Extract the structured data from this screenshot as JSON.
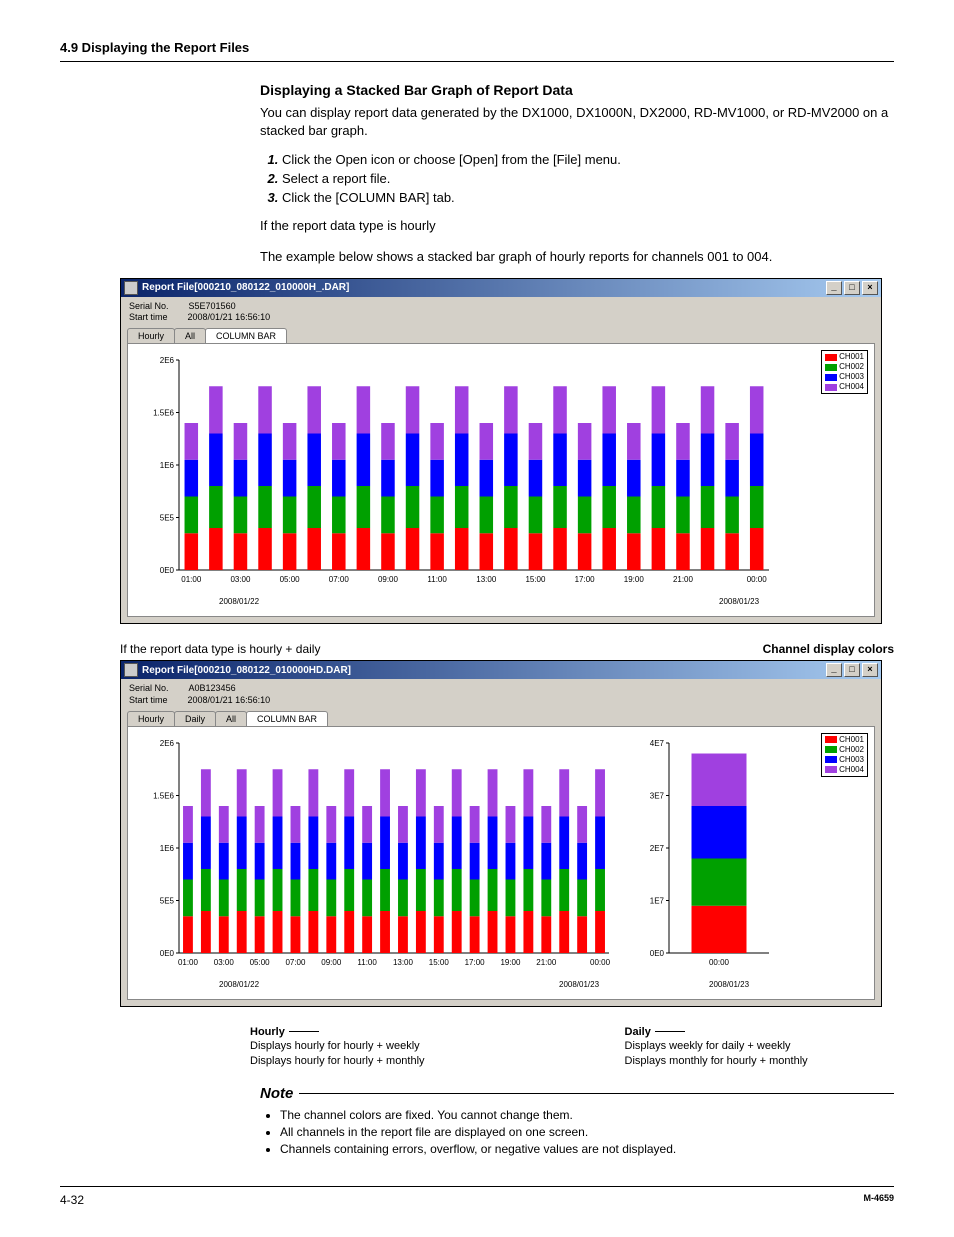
{
  "page": {
    "header": "4.9  Displaying the Report Files",
    "footer_left": "4-32",
    "footer_right": "M-4659"
  },
  "body": {
    "title": "Displaying a Stacked Bar Graph of Report Data",
    "intro": "You can display report data generated by the DX1000, DX1000N, DX2000, RD-MV1000, or RD-MV2000 on a stacked bar graph.",
    "steps": [
      "Click the Open icon or choose [Open] from the [File] menu.",
      "Select a report file.",
      "Click the [COLUMN BAR] tab."
    ],
    "if_hourly_head": "If the report data type is hourly",
    "if_hourly_text": "The example below shows a stacked bar graph of hourly reports for channels 001 to 004.",
    "caption_hourly_daily": "If the report data type is hourly + daily",
    "caption_channel_colors": "Channel display colors",
    "annotations": {
      "hourly": {
        "title": "Hourly",
        "lines": [
          "Displays hourly for hourly + weekly",
          "Displays hourly for hourly + monthly"
        ]
      },
      "daily": {
        "title": "Daily",
        "lines": [
          "Displays weekly for daily + weekly",
          "Displays monthly for hourly + monthly"
        ]
      }
    },
    "note_title": "Note",
    "notes": [
      "The channel colors are fixed. You cannot change them.",
      "All channels in the report file are displayed on one screen.",
      "Channels containing errors, overflow, or negative values are not displayed."
    ]
  },
  "window1": {
    "title": "Report File[000210_080122_010000H_.DAR]",
    "serial_label": "Serial No.",
    "serial_value": "S5E701560",
    "start_label": "Start time",
    "start_value": "2008/01/21 16:56:10",
    "tabs": [
      "Hourly",
      "All",
      "COLUMN BAR"
    ],
    "active_tab": 2,
    "dates": [
      "2008/01/22",
      "2008/01/23"
    ]
  },
  "window2": {
    "title": "Report File[000210_080122_010000HD.DAR]",
    "serial_label": "Serial No.",
    "serial_value": "A0B123456",
    "start_label": "Start time",
    "start_value": "2008/01/21 16:56:10",
    "tabs": [
      "Hourly",
      "Daily",
      "All",
      "COLUMN BAR"
    ],
    "active_tab": 3,
    "dates": [
      "2008/01/22",
      "2008/01/23",
      "2008/01/23"
    ]
  },
  "legend": [
    {
      "name": "CH001",
      "color": "#ff0000"
    },
    {
      "name": "CH002",
      "color": "#00a000"
    },
    {
      "name": "CH003",
      "color": "#0000ff"
    },
    {
      "name": "CH004",
      "color": "#a040e0"
    }
  ],
  "chart_data": [
    {
      "type": "bar",
      "stacked": true,
      "title": "Hourly report stacked bar",
      "ylabel": "",
      "ylim": [
        0,
        2000000
      ],
      "y_ticks_labels": [
        "0E0",
        "5E5",
        "1E6",
        "1.5E6",
        "2E6"
      ],
      "x_label_positions": [
        "01:00",
        "03:00",
        "05:00",
        "07:00",
        "09:00",
        "11:00",
        "13:00",
        "15:00",
        "17:00",
        "19:00",
        "21:00",
        "00:00"
      ],
      "categories": [
        "01:00",
        "02:00",
        "03:00",
        "04:00",
        "05:00",
        "06:00",
        "07:00",
        "08:00",
        "09:00",
        "10:00",
        "11:00",
        "12:00",
        "13:00",
        "14:00",
        "15:00",
        "16:00",
        "17:00",
        "18:00",
        "19:00",
        "20:00",
        "21:00",
        "22:00",
        "23:00",
        "00:00"
      ],
      "series": [
        {
          "name": "CH001",
          "color": "#ff0000",
          "values": [
            350000,
            400000,
            350000,
            400000,
            350000,
            400000,
            350000,
            400000,
            350000,
            400000,
            350000,
            400000,
            350000,
            400000,
            350000,
            400000,
            350000,
            400000,
            350000,
            400000,
            350000,
            400000,
            350000,
            400000
          ]
        },
        {
          "name": "CH002",
          "color": "#00a000",
          "values": [
            350000,
            400000,
            350000,
            400000,
            350000,
            400000,
            350000,
            400000,
            350000,
            400000,
            350000,
            400000,
            350000,
            400000,
            350000,
            400000,
            350000,
            400000,
            350000,
            400000,
            350000,
            400000,
            350000,
            400000
          ]
        },
        {
          "name": "CH003",
          "color": "#0000ff",
          "values": [
            350000,
            500000,
            350000,
            500000,
            350000,
            500000,
            350000,
            500000,
            350000,
            500000,
            350000,
            500000,
            350000,
            500000,
            350000,
            500000,
            350000,
            500000,
            350000,
            500000,
            350000,
            500000,
            350000,
            500000
          ]
        },
        {
          "name": "CH004",
          "color": "#a040e0",
          "values": [
            350000,
            450000,
            350000,
            450000,
            350000,
            450000,
            350000,
            450000,
            350000,
            450000,
            350000,
            450000,
            350000,
            450000,
            350000,
            450000,
            350000,
            450000,
            350000,
            450000,
            350000,
            450000,
            350000,
            450000
          ]
        }
      ]
    },
    {
      "type": "bar",
      "stacked": true,
      "title": "Hourly (hourly+daily) stacked bar",
      "ylim": [
        0,
        2000000
      ],
      "y_ticks_labels": [
        "0E0",
        "5E5",
        "1E6",
        "1.5E6",
        "2E6"
      ],
      "x_label_positions": [
        "01:00",
        "03:00",
        "05:00",
        "07:00",
        "09:00",
        "11:00",
        "13:00",
        "15:00",
        "17:00",
        "19:00",
        "21:00",
        "00:00"
      ],
      "categories": [
        "01:00",
        "02:00",
        "03:00",
        "04:00",
        "05:00",
        "06:00",
        "07:00",
        "08:00",
        "09:00",
        "10:00",
        "11:00",
        "12:00",
        "13:00",
        "14:00",
        "15:00",
        "16:00",
        "17:00",
        "18:00",
        "19:00",
        "20:00",
        "21:00",
        "22:00",
        "23:00",
        "00:00"
      ],
      "series": [
        {
          "name": "CH001",
          "color": "#ff0000",
          "values": [
            350000,
            400000,
            350000,
            400000,
            350000,
            400000,
            350000,
            400000,
            350000,
            400000,
            350000,
            400000,
            350000,
            400000,
            350000,
            400000,
            350000,
            400000,
            350000,
            400000,
            350000,
            400000,
            350000,
            400000
          ]
        },
        {
          "name": "CH002",
          "color": "#00a000",
          "values": [
            350000,
            400000,
            350000,
            400000,
            350000,
            400000,
            350000,
            400000,
            350000,
            400000,
            350000,
            400000,
            350000,
            400000,
            350000,
            400000,
            350000,
            400000,
            350000,
            400000,
            350000,
            400000,
            350000,
            400000
          ]
        },
        {
          "name": "CH003",
          "color": "#0000ff",
          "values": [
            350000,
            500000,
            350000,
            500000,
            350000,
            500000,
            350000,
            500000,
            350000,
            500000,
            350000,
            500000,
            350000,
            500000,
            350000,
            500000,
            350000,
            500000,
            350000,
            500000,
            350000,
            500000,
            350000,
            500000
          ]
        },
        {
          "name": "CH004",
          "color": "#a040e0",
          "values": [
            350000,
            450000,
            350000,
            450000,
            350000,
            450000,
            350000,
            450000,
            350000,
            450000,
            350000,
            450000,
            350000,
            450000,
            350000,
            450000,
            350000,
            450000,
            350000,
            450000,
            350000,
            450000,
            350000,
            450000
          ]
        }
      ]
    },
    {
      "type": "bar",
      "stacked": true,
      "title": "Daily (hourly+daily) stacked bar",
      "ylim": [
        0,
        40000000
      ],
      "y_ticks_labels": [
        "0E0",
        "1E7",
        "2E7",
        "3E7",
        "4E7"
      ],
      "categories": [
        "00:00"
      ],
      "series": [
        {
          "name": "CH001",
          "color": "#ff0000",
          "values": [
            9000000
          ]
        },
        {
          "name": "CH002",
          "color": "#00a000",
          "values": [
            9000000
          ]
        },
        {
          "name": "CH003",
          "color": "#0000ff",
          "values": [
            10000000
          ]
        },
        {
          "name": "CH004",
          "color": "#a040e0",
          "values": [
            10000000
          ]
        }
      ]
    }
  ]
}
